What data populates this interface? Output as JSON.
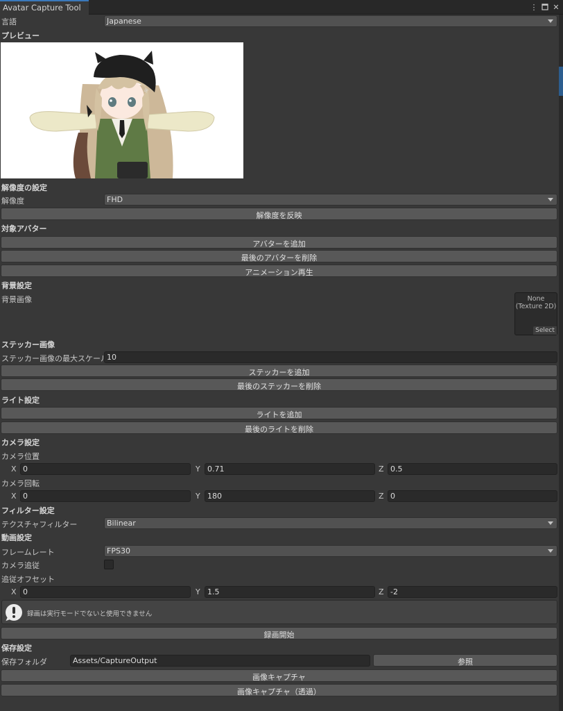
{
  "window": {
    "tab_title": "Avatar Capture Tool",
    "icons": [
      "kebab-menu-icon",
      "maximize-icon",
      "close-icon"
    ]
  },
  "language": {
    "label": "言語",
    "value": "Japanese"
  },
  "preview": {
    "header": "プレビュー"
  },
  "resolution": {
    "header": "解像度の設定",
    "label": "解像度",
    "value": "FHD",
    "apply_button": "解像度を反映"
  },
  "avatars": {
    "header": "対象アバター",
    "add_button": "アバターを追加",
    "remove_button": "最後のアバターを削除",
    "play_button": "アニメーション再生"
  },
  "background": {
    "header": "背景設定",
    "image_label": "背景画像",
    "slot_value": "None",
    "slot_type": "(Texture 2D)",
    "slot_select": "Select"
  },
  "stickers": {
    "header": "ステッカー画像",
    "max_scale_label": "ステッカー画像の最大スケール",
    "max_scale_value": "10",
    "add_button": "ステッカーを追加",
    "remove_button": "最後のステッカーを削除"
  },
  "lights": {
    "header": "ライト設定",
    "add_button": "ライトを追加",
    "remove_button": "最後のライトを削除"
  },
  "camera": {
    "header": "カメラ設定",
    "position_label": "カメラ位置",
    "position": {
      "x": "0",
      "y": "0.71",
      "z": "0.5"
    },
    "rotation_label": "カメラ回転",
    "rotation": {
      "x": "0",
      "y": "180",
      "z": "0"
    },
    "axis_x": "X",
    "axis_y": "Y",
    "axis_z": "Z"
  },
  "filter": {
    "header": "フィルター設定",
    "label": "テクスチャフィルター",
    "value": "Bilinear"
  },
  "video": {
    "header": "動画設定",
    "framerate_label": "フレームレート",
    "framerate_value": "FPS30",
    "follow_label": "カメラ追従",
    "follow_checked": false,
    "offset_label": "追従オフセット",
    "offset": {
      "x": "0",
      "y": "1.5",
      "z": "-2"
    },
    "warning": "録画は実行モードでないと使用できません",
    "record_button": "録画開始"
  },
  "save": {
    "header": "保存設定",
    "folder_label": "保存フォルダ",
    "folder_value": "Assets/CaptureOutput",
    "browse_button": "参照",
    "capture_button": "画像キャプチャ",
    "capture_transparent_button": "画像キャプチャ（透過）"
  },
  "colors": {
    "panel_bg": "#383838",
    "tab_accent": "#3a79bb",
    "button_bg": "#585858",
    "field_bg": "#2a2a2a"
  }
}
